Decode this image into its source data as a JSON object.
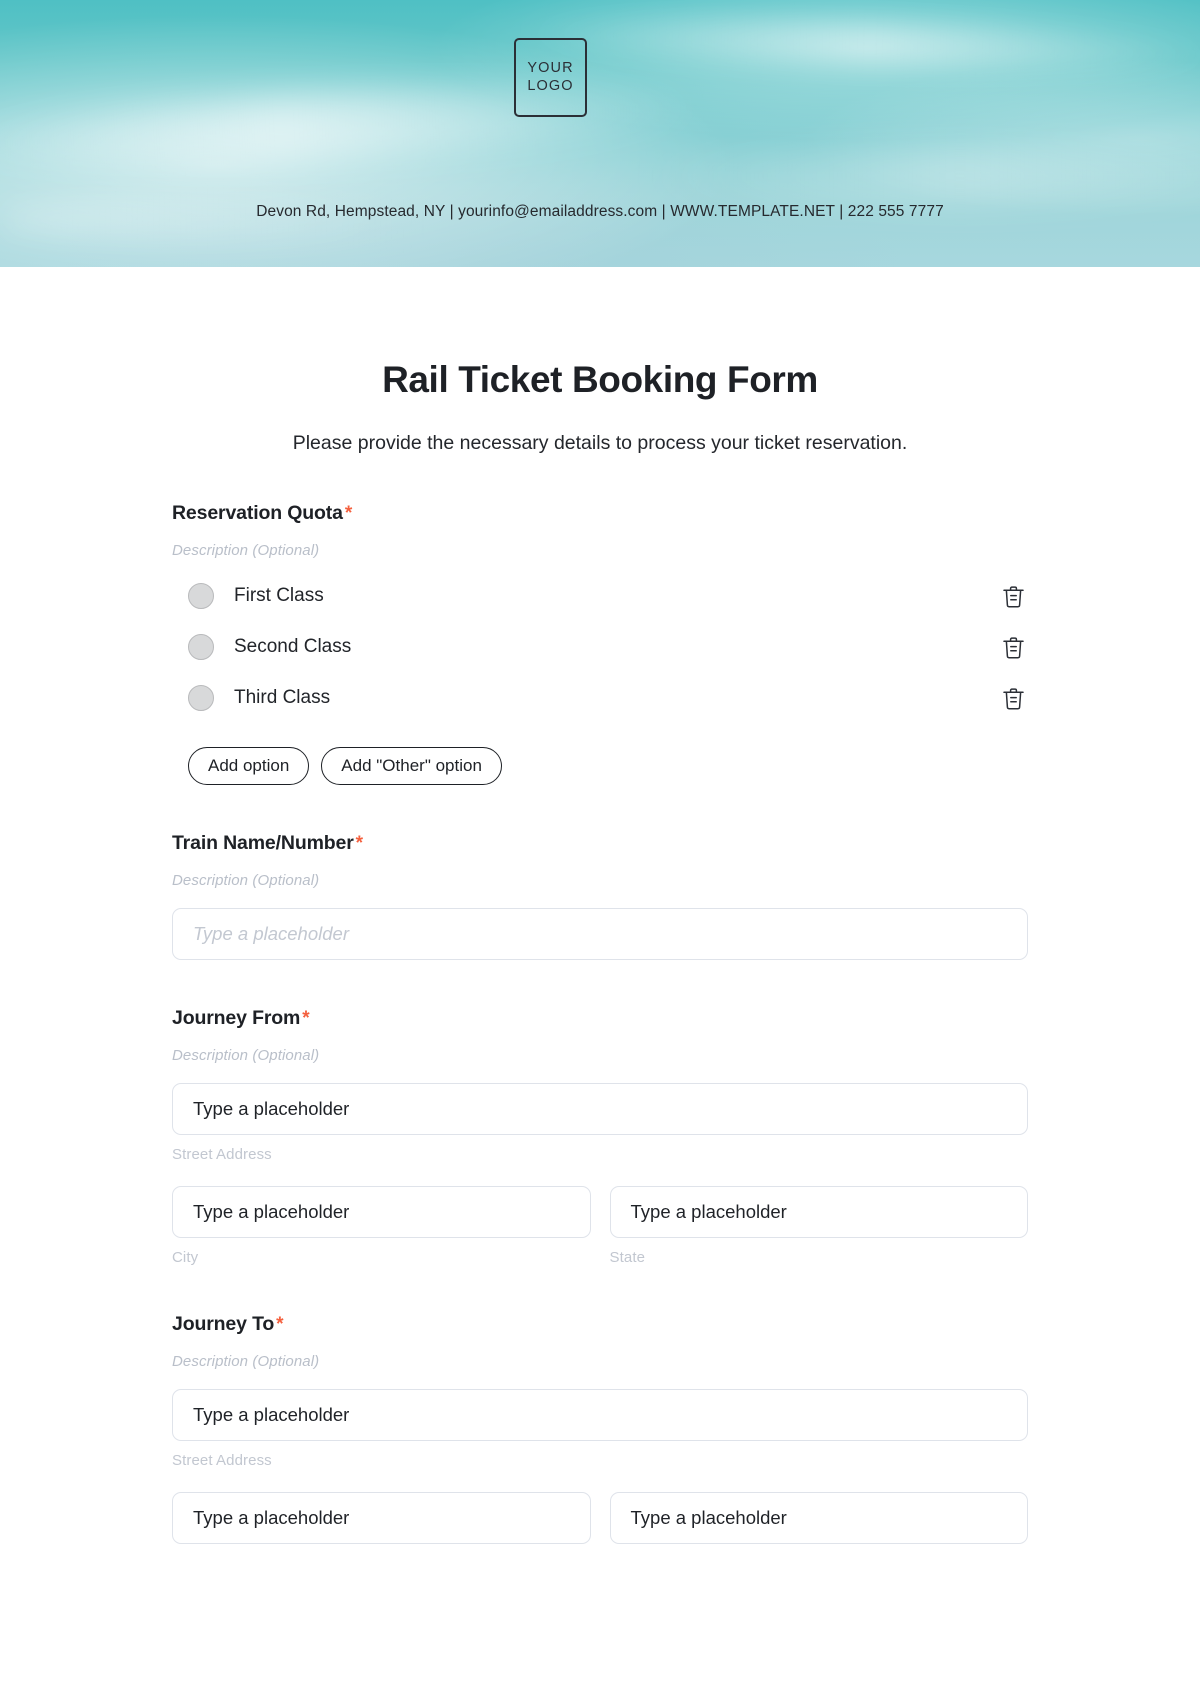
{
  "brand": {
    "logo_line1": "YOUR",
    "logo_line2": "LOGO",
    "accent_banner": "#84cfd3",
    "required_color": "#f4603e"
  },
  "header": {
    "contact": "Devon Rd, Hempstead, NY | yourinfo@emailaddress.com | WWW.TEMPLATE.NET | 222 555 7777"
  },
  "form": {
    "title": "Rail Ticket Booking Form",
    "subtitle": "Please provide the necessary details to process your ticket reservation.",
    "required_mark": "*",
    "description_placeholder": "Description (Optional)",
    "input_placeholder": "Type a placeholder"
  },
  "sections": {
    "reservation_quota": {
      "label": "Reservation Quota",
      "description": "Description (Optional)",
      "options": [
        {
          "label": "First Class"
        },
        {
          "label": "Second Class"
        },
        {
          "label": "Third Class"
        }
      ],
      "add_option_label": "Add option",
      "add_other_option_label": "Add \"Other\" option"
    },
    "train_name": {
      "label": "Train Name/Number",
      "description": "Description (Optional)",
      "placeholder": "Type a placeholder"
    },
    "journey_from": {
      "label": "Journey From",
      "description": "Description (Optional)",
      "street_value": "Type a placeholder",
      "street_sub_label": "Street Address",
      "city_value": "Type a placeholder",
      "city_sub_label": "City",
      "state_value": "Type a placeholder",
      "state_sub_label": "State"
    },
    "journey_to": {
      "label": "Journey To",
      "description": "Description (Optional)",
      "street_value": "Type a placeholder",
      "street_sub_label": "Street Address",
      "city_value": "Type a placeholder",
      "state_value": "Type a placeholder"
    }
  },
  "icons": {
    "delete": "trash-icon"
  }
}
